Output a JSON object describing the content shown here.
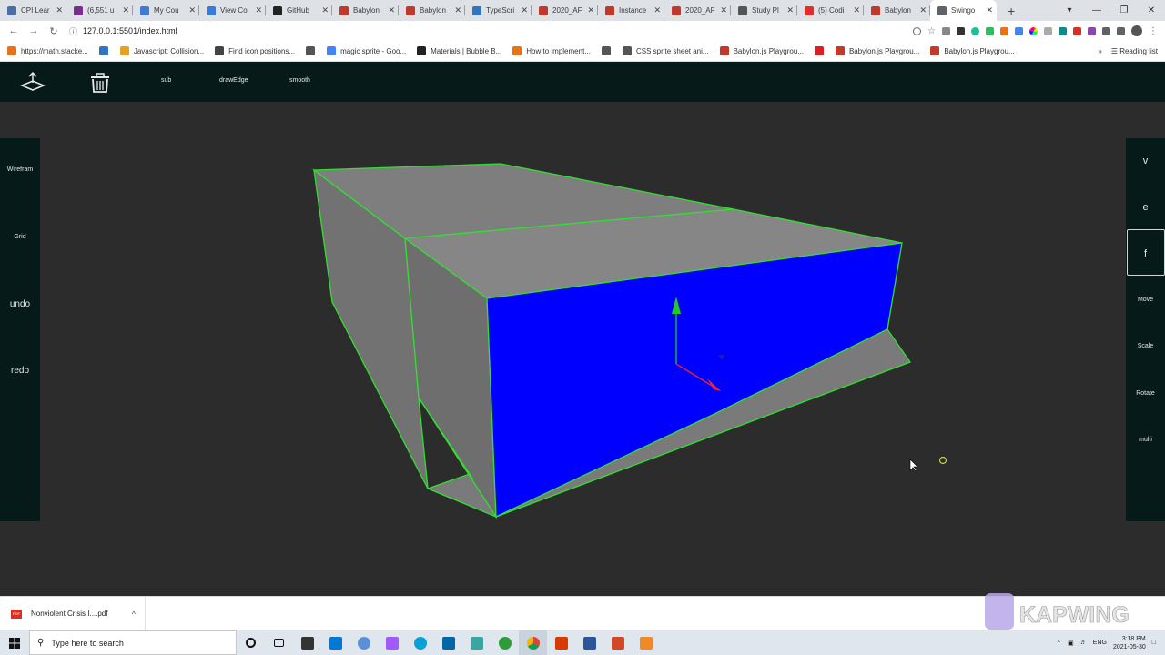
{
  "browser": {
    "tabs": [
      {
        "label": "CPI Lear",
        "color": "#4a6fa5"
      },
      {
        "label": "(6,551 u",
        "color": "#7b2d8e"
      },
      {
        "label": "My Cou",
        "color": "#3a7bd5"
      },
      {
        "label": "View Co",
        "color": "#3a7bd5"
      },
      {
        "label": "GitHub",
        "color": "#222222"
      },
      {
        "label": "Babylon",
        "color": "#c0392b"
      },
      {
        "label": "Babylon",
        "color": "#c0392b"
      },
      {
        "label": "TypeScri",
        "color": "#2f74c0"
      },
      {
        "label": "2020_AF",
        "color": "#c0392b"
      },
      {
        "label": "Instance",
        "color": "#c0392b"
      },
      {
        "label": "2020_AF",
        "color": "#c0392b"
      },
      {
        "label": "Study Pl",
        "color": "#555555"
      },
      {
        "label": "(5) Codi",
        "color": "#e52d27"
      },
      {
        "label": "Babylon",
        "color": "#c0392b"
      },
      {
        "label": "Swingo",
        "color": "#5f6368"
      }
    ],
    "close_glyph": "✕",
    "new_tab": "+",
    "url": "127.0.0.1:5501/index.html",
    "bookmarks": [
      {
        "label": "https://math.stacke...",
        "color": "#e8711a"
      },
      {
        "label": "",
        "color": "#2f74c0"
      },
      {
        "label": "Javascript: Collision...",
        "color": "#e8a020"
      },
      {
        "label": "Find icon positions...",
        "color": "#444444"
      },
      {
        "label": "",
        "color": "#555555"
      },
      {
        "label": "magic sprite - Goo...",
        "color": "#4285f4"
      },
      {
        "label": "Materials | Bubble B...",
        "color": "#222222"
      },
      {
        "label": "How to implement...",
        "color": "#e8711a"
      },
      {
        "label": "",
        "color": "#555555"
      },
      {
        "label": "CSS sprite sheet ani...",
        "color": "#555555"
      },
      {
        "label": "Babylon.js Playgrou...",
        "color": "#c0392b"
      },
      {
        "label": "",
        "color": "#d81f26"
      },
      {
        "label": "Babylon.js Playgrou...",
        "color": "#c0392b"
      },
      {
        "label": "Babylon.js Playgrou...",
        "color": "#c0392b"
      }
    ],
    "reading_list": "Reading list",
    "more": "»"
  },
  "app": {
    "toolbar": {
      "sub": "sub",
      "drawEdge": "drawEdge",
      "smooth": "smooth"
    },
    "left_panel": [
      "Wirefram",
      "Grid",
      "undo",
      "redo"
    ],
    "right_panel": [
      "v",
      "e",
      "f",
      "Move",
      "Scale",
      "Rotate",
      "multi"
    ],
    "selected_mode": "f",
    "colors": {
      "panel": "#071a1a",
      "viewport": "#2c2c2c",
      "face_selected": "#0000ff",
      "edge": "#33dd33",
      "face": "#7a7a7a"
    }
  },
  "downloads": {
    "file": "Nonviolent Crisis I....pdf",
    "pdf_badge": "PDF",
    "chevron": "^"
  },
  "taskbar": {
    "search_placeholder": "Type here to search",
    "lang": "ENG",
    "time": "3:18 PM",
    "date": "2021-05-30"
  },
  "watermark": {
    "text": "KAPWING"
  }
}
